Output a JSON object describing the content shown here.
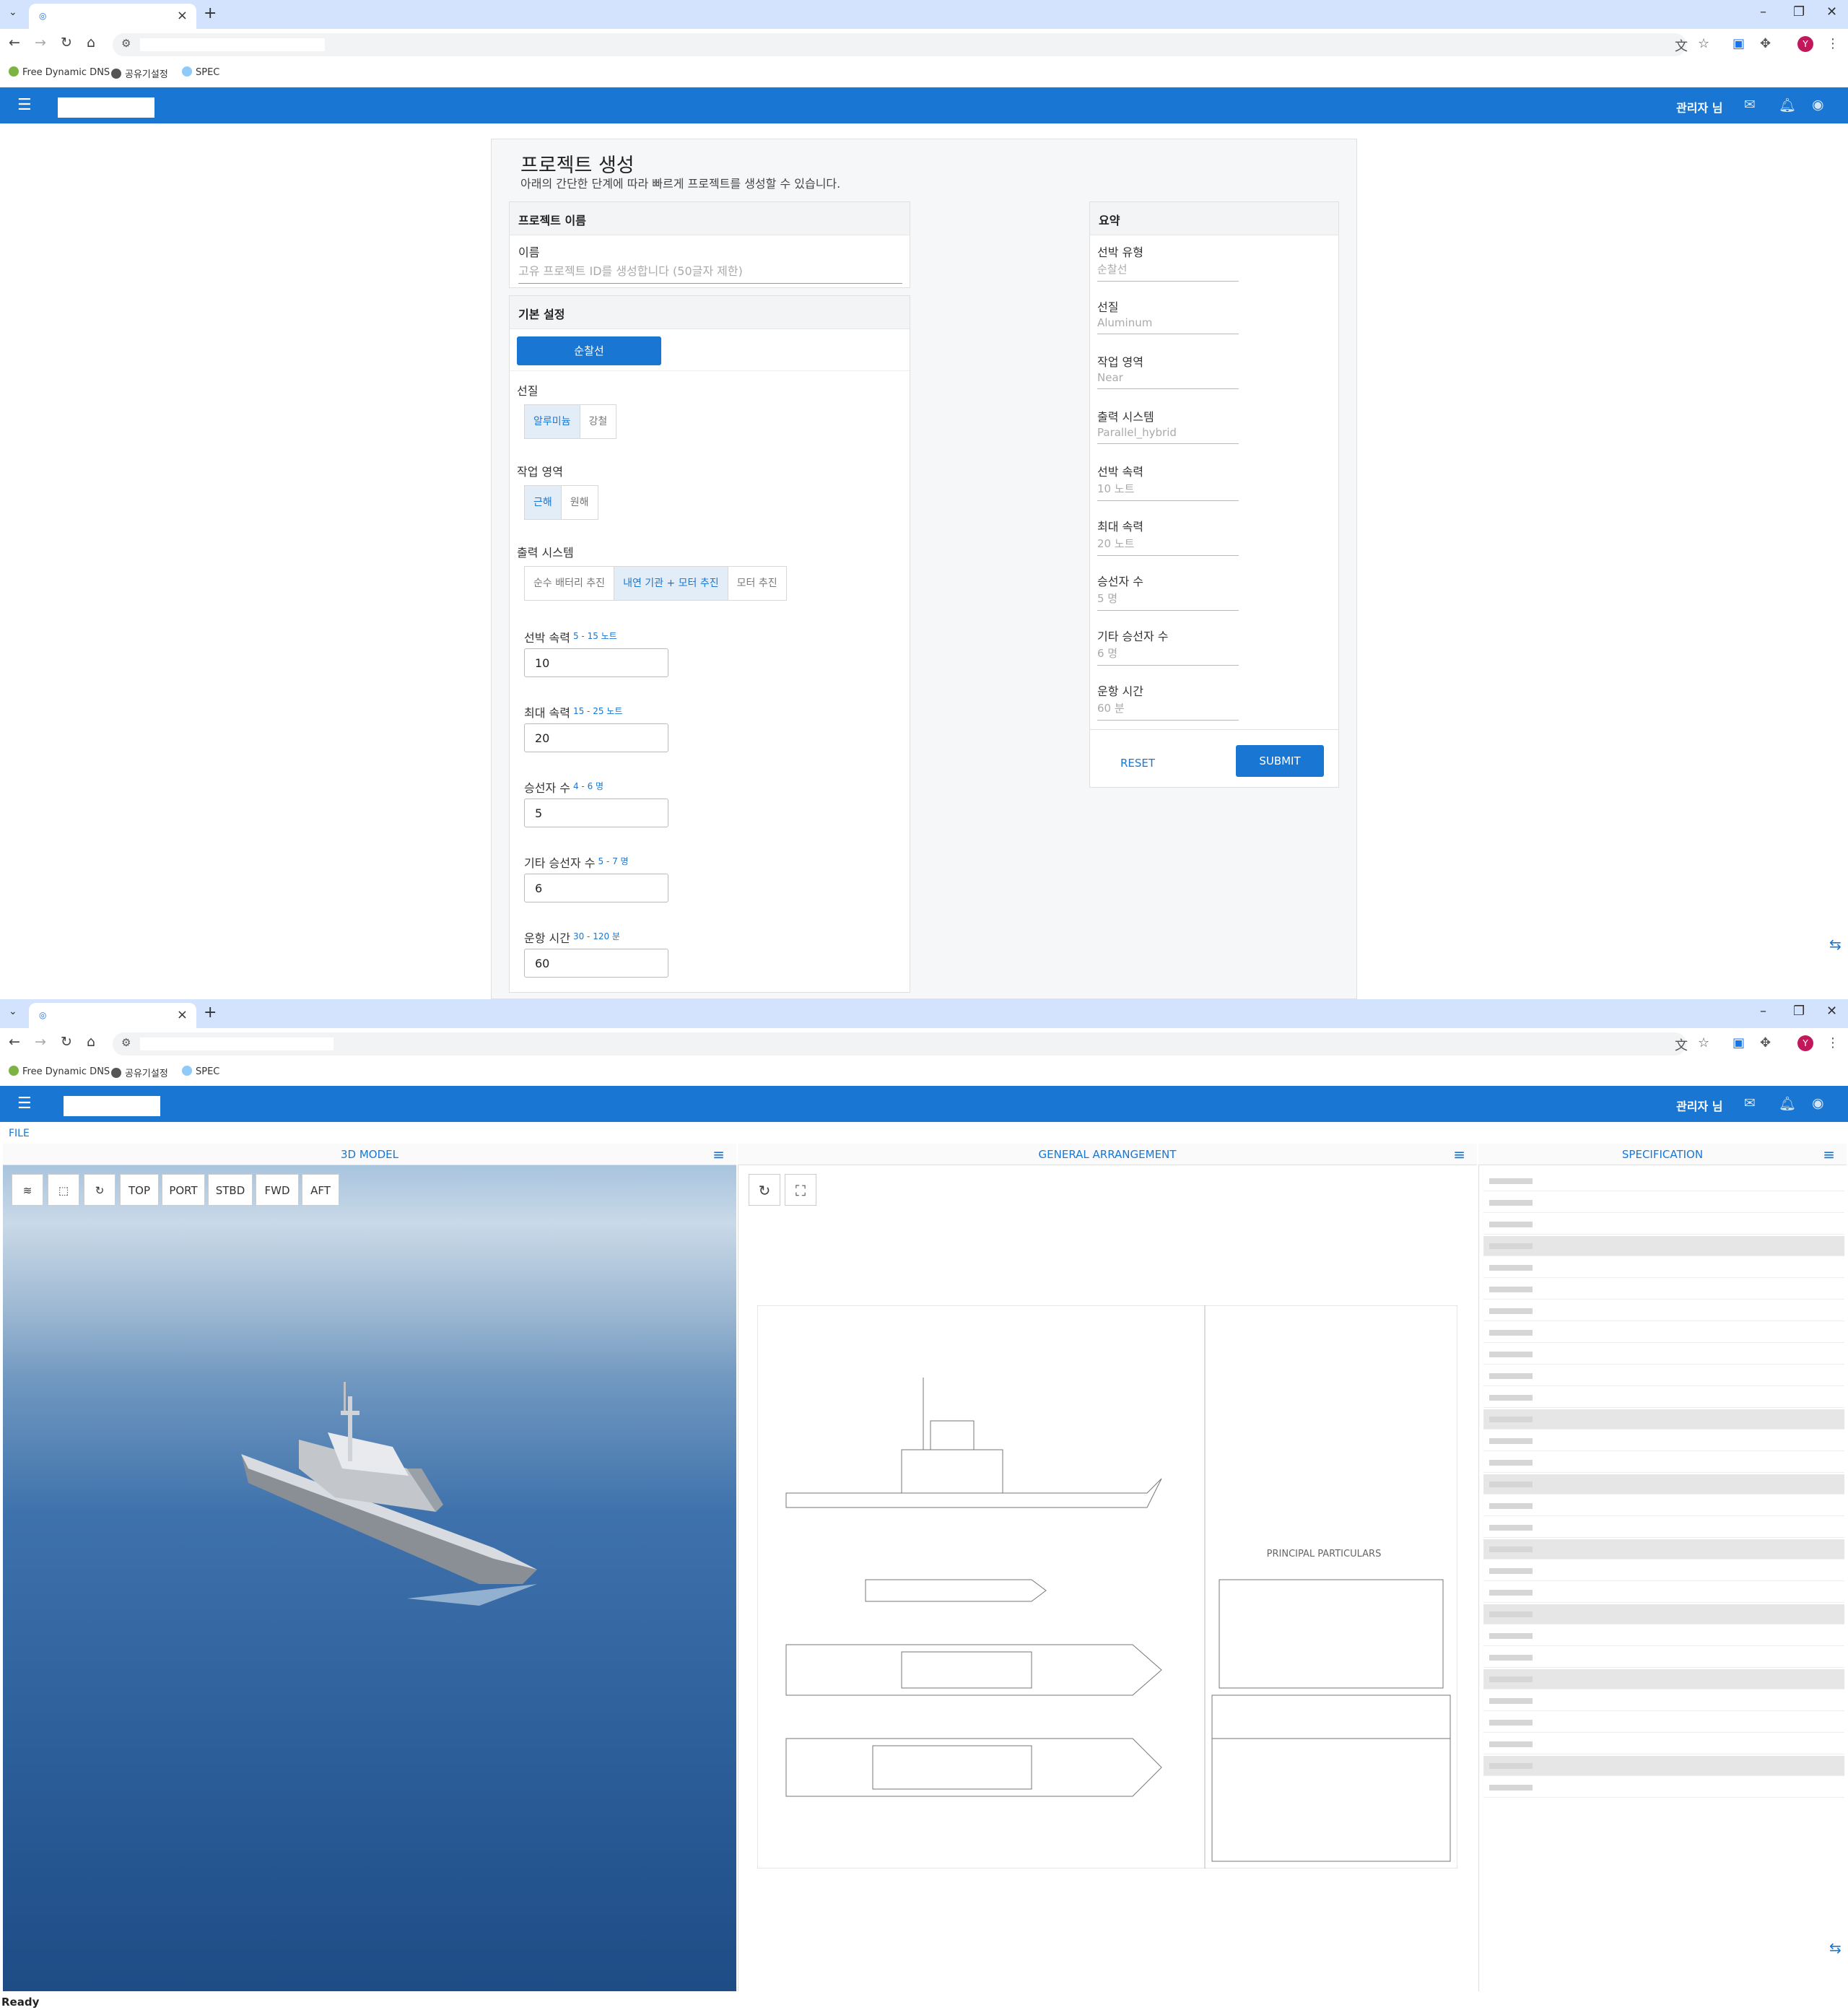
{
  "browser": {
    "bookmarks": [
      "Free Dynamic DNS",
      "공유기설정",
      "SPEC"
    ],
    "profile_initial": "Y"
  },
  "appbar": {
    "user": "관리자 님"
  },
  "form": {
    "title": "프로젝트 생성",
    "subtitle": "아래의 간단한 단계에 따라 빠르게 프로젝트를 생성할 수 있습니다.",
    "name_card": {
      "header": "프로젝트 이름",
      "label": "이름",
      "placeholder": "고유 프로젝트 ID를 생성합니다 (50글자 제한)"
    },
    "basic": {
      "header": "기본 설정",
      "type_button": "순찰선",
      "hull_label": "선질",
      "hull_options": [
        "알루미늄",
        "강철"
      ],
      "area_label": "작업 영역",
      "area_options": [
        "근해",
        "원해"
      ],
      "power_label": "출력 시스템",
      "power_options": [
        "순수 배터리 추진",
        "내연 기관 + 모터 추진",
        "모터 추진"
      ],
      "speed": {
        "label": "선박 속력",
        "hint": "5 - 15 노트",
        "value": "10"
      },
      "maxspeed": {
        "label": "최대 속력",
        "hint": "15 - 25 노트",
        "value": "20"
      },
      "crew": {
        "label": "승선자 수",
        "hint": "4 - 6 명",
        "value": "5"
      },
      "other": {
        "label": "기타 승선자 수",
        "hint": "5 - 7 명",
        "value": "6"
      },
      "time": {
        "label": "운항 시간",
        "hint": "30 - 120 분",
        "value": "60"
      }
    },
    "summary": {
      "header": "요약",
      "items": [
        {
          "k": "선박 유형",
          "v": "순찰선"
        },
        {
          "k": "선질",
          "v": "Aluminum"
        },
        {
          "k": "작업 영역",
          "v": "Near"
        },
        {
          "k": "출력 시스템",
          "v": "Parallel_hybrid"
        },
        {
          "k": "선박 속력",
          "v": "10 노트"
        },
        {
          "k": "최대 속력",
          "v": "20 노트"
        },
        {
          "k": "승선자 수",
          "v": "5 명"
        },
        {
          "k": "기타 승선자 수",
          "v": "6 명"
        },
        {
          "k": "운항 시간",
          "v": "60 분"
        }
      ],
      "reset": "RESET",
      "submit": "SUBMIT"
    }
  },
  "viewer": {
    "file_menu": "FILE",
    "panels": [
      "3D MODEL",
      "GENERAL ARRANGEMENT",
      "SPECIFICATION"
    ],
    "view_buttons": [
      "TOP",
      "PORT",
      "STBD",
      "FWD",
      "AFT"
    ],
    "ga_title": "PRINCIPAL PARTICULARS"
  },
  "status": "Ready"
}
